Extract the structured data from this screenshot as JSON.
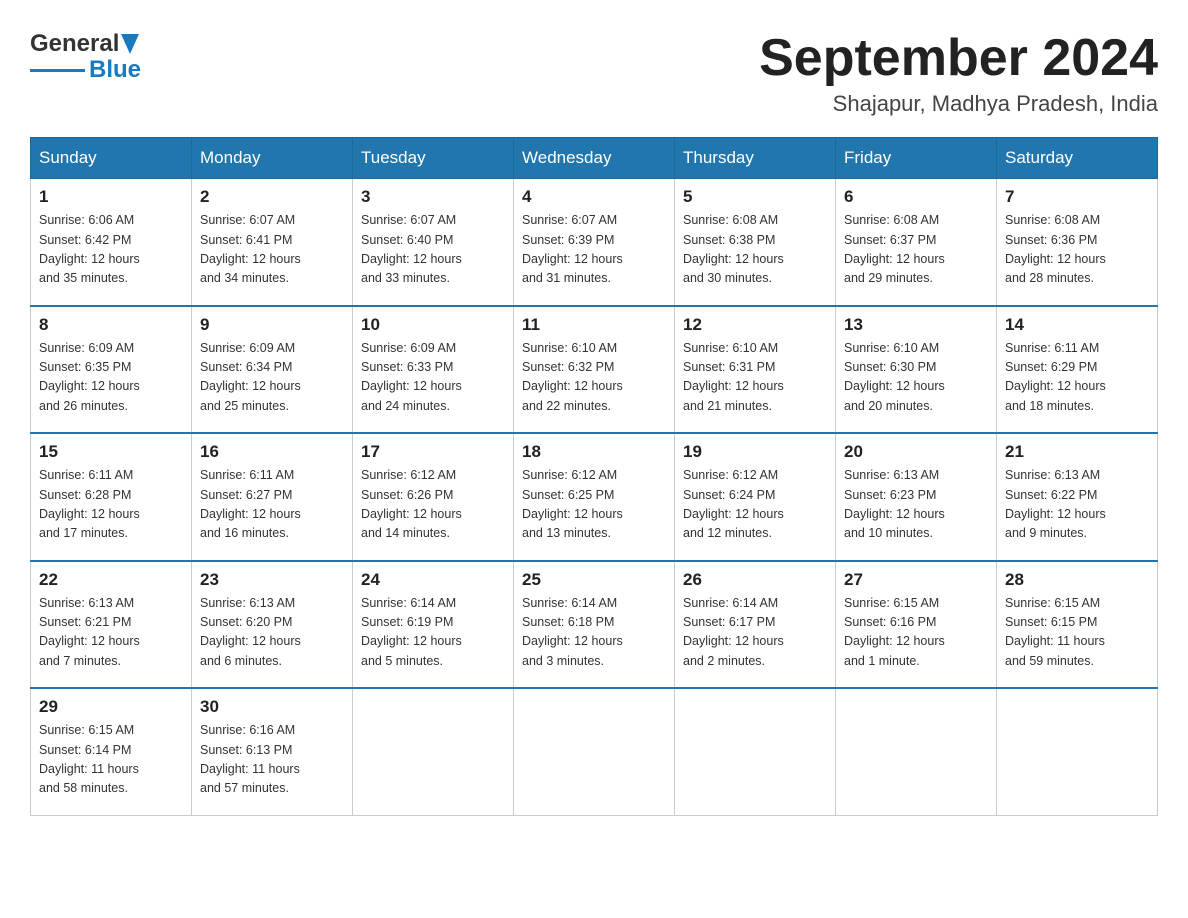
{
  "logo": {
    "name": "General",
    "name2": "Blue"
  },
  "title": "September 2024",
  "location": "Shajapur, Madhya Pradesh, India",
  "headers": [
    "Sunday",
    "Monday",
    "Tuesday",
    "Wednesday",
    "Thursday",
    "Friday",
    "Saturday"
  ],
  "weeks": [
    [
      {
        "day": "1",
        "sunrise": "6:06 AM",
        "sunset": "6:42 PM",
        "daylight": "12 hours and 35 minutes."
      },
      {
        "day": "2",
        "sunrise": "6:07 AM",
        "sunset": "6:41 PM",
        "daylight": "12 hours and 34 minutes."
      },
      {
        "day": "3",
        "sunrise": "6:07 AM",
        "sunset": "6:40 PM",
        "daylight": "12 hours and 33 minutes."
      },
      {
        "day": "4",
        "sunrise": "6:07 AM",
        "sunset": "6:39 PM",
        "daylight": "12 hours and 31 minutes."
      },
      {
        "day": "5",
        "sunrise": "6:08 AM",
        "sunset": "6:38 PM",
        "daylight": "12 hours and 30 minutes."
      },
      {
        "day": "6",
        "sunrise": "6:08 AM",
        "sunset": "6:37 PM",
        "daylight": "12 hours and 29 minutes."
      },
      {
        "day": "7",
        "sunrise": "6:08 AM",
        "sunset": "6:36 PM",
        "daylight": "12 hours and 28 minutes."
      }
    ],
    [
      {
        "day": "8",
        "sunrise": "6:09 AM",
        "sunset": "6:35 PM",
        "daylight": "12 hours and 26 minutes."
      },
      {
        "day": "9",
        "sunrise": "6:09 AM",
        "sunset": "6:34 PM",
        "daylight": "12 hours and 25 minutes."
      },
      {
        "day": "10",
        "sunrise": "6:09 AM",
        "sunset": "6:33 PM",
        "daylight": "12 hours and 24 minutes."
      },
      {
        "day": "11",
        "sunrise": "6:10 AM",
        "sunset": "6:32 PM",
        "daylight": "12 hours and 22 minutes."
      },
      {
        "day": "12",
        "sunrise": "6:10 AM",
        "sunset": "6:31 PM",
        "daylight": "12 hours and 21 minutes."
      },
      {
        "day": "13",
        "sunrise": "6:10 AM",
        "sunset": "6:30 PM",
        "daylight": "12 hours and 20 minutes."
      },
      {
        "day": "14",
        "sunrise": "6:11 AM",
        "sunset": "6:29 PM",
        "daylight": "12 hours and 18 minutes."
      }
    ],
    [
      {
        "day": "15",
        "sunrise": "6:11 AM",
        "sunset": "6:28 PM",
        "daylight": "12 hours and 17 minutes."
      },
      {
        "day": "16",
        "sunrise": "6:11 AM",
        "sunset": "6:27 PM",
        "daylight": "12 hours and 16 minutes."
      },
      {
        "day": "17",
        "sunrise": "6:12 AM",
        "sunset": "6:26 PM",
        "daylight": "12 hours and 14 minutes."
      },
      {
        "day": "18",
        "sunrise": "6:12 AM",
        "sunset": "6:25 PM",
        "daylight": "12 hours and 13 minutes."
      },
      {
        "day": "19",
        "sunrise": "6:12 AM",
        "sunset": "6:24 PM",
        "daylight": "12 hours and 12 minutes."
      },
      {
        "day": "20",
        "sunrise": "6:13 AM",
        "sunset": "6:23 PM",
        "daylight": "12 hours and 10 minutes."
      },
      {
        "day": "21",
        "sunrise": "6:13 AM",
        "sunset": "6:22 PM",
        "daylight": "12 hours and 9 minutes."
      }
    ],
    [
      {
        "day": "22",
        "sunrise": "6:13 AM",
        "sunset": "6:21 PM",
        "daylight": "12 hours and 7 minutes."
      },
      {
        "day": "23",
        "sunrise": "6:13 AM",
        "sunset": "6:20 PM",
        "daylight": "12 hours and 6 minutes."
      },
      {
        "day": "24",
        "sunrise": "6:14 AM",
        "sunset": "6:19 PM",
        "daylight": "12 hours and 5 minutes."
      },
      {
        "day": "25",
        "sunrise": "6:14 AM",
        "sunset": "6:18 PM",
        "daylight": "12 hours and 3 minutes."
      },
      {
        "day": "26",
        "sunrise": "6:14 AM",
        "sunset": "6:17 PM",
        "daylight": "12 hours and 2 minutes."
      },
      {
        "day": "27",
        "sunrise": "6:15 AM",
        "sunset": "6:16 PM",
        "daylight": "12 hours and 1 minute."
      },
      {
        "day": "28",
        "sunrise": "6:15 AM",
        "sunset": "6:15 PM",
        "daylight": "11 hours and 59 minutes."
      }
    ],
    [
      {
        "day": "29",
        "sunrise": "6:15 AM",
        "sunset": "6:14 PM",
        "daylight": "11 hours and 58 minutes."
      },
      {
        "day": "30",
        "sunrise": "6:16 AM",
        "sunset": "6:13 PM",
        "daylight": "11 hours and 57 minutes."
      },
      null,
      null,
      null,
      null,
      null
    ]
  ],
  "labels": {
    "sunrise": "Sunrise:",
    "sunset": "Sunset:",
    "daylight": "Daylight:"
  }
}
